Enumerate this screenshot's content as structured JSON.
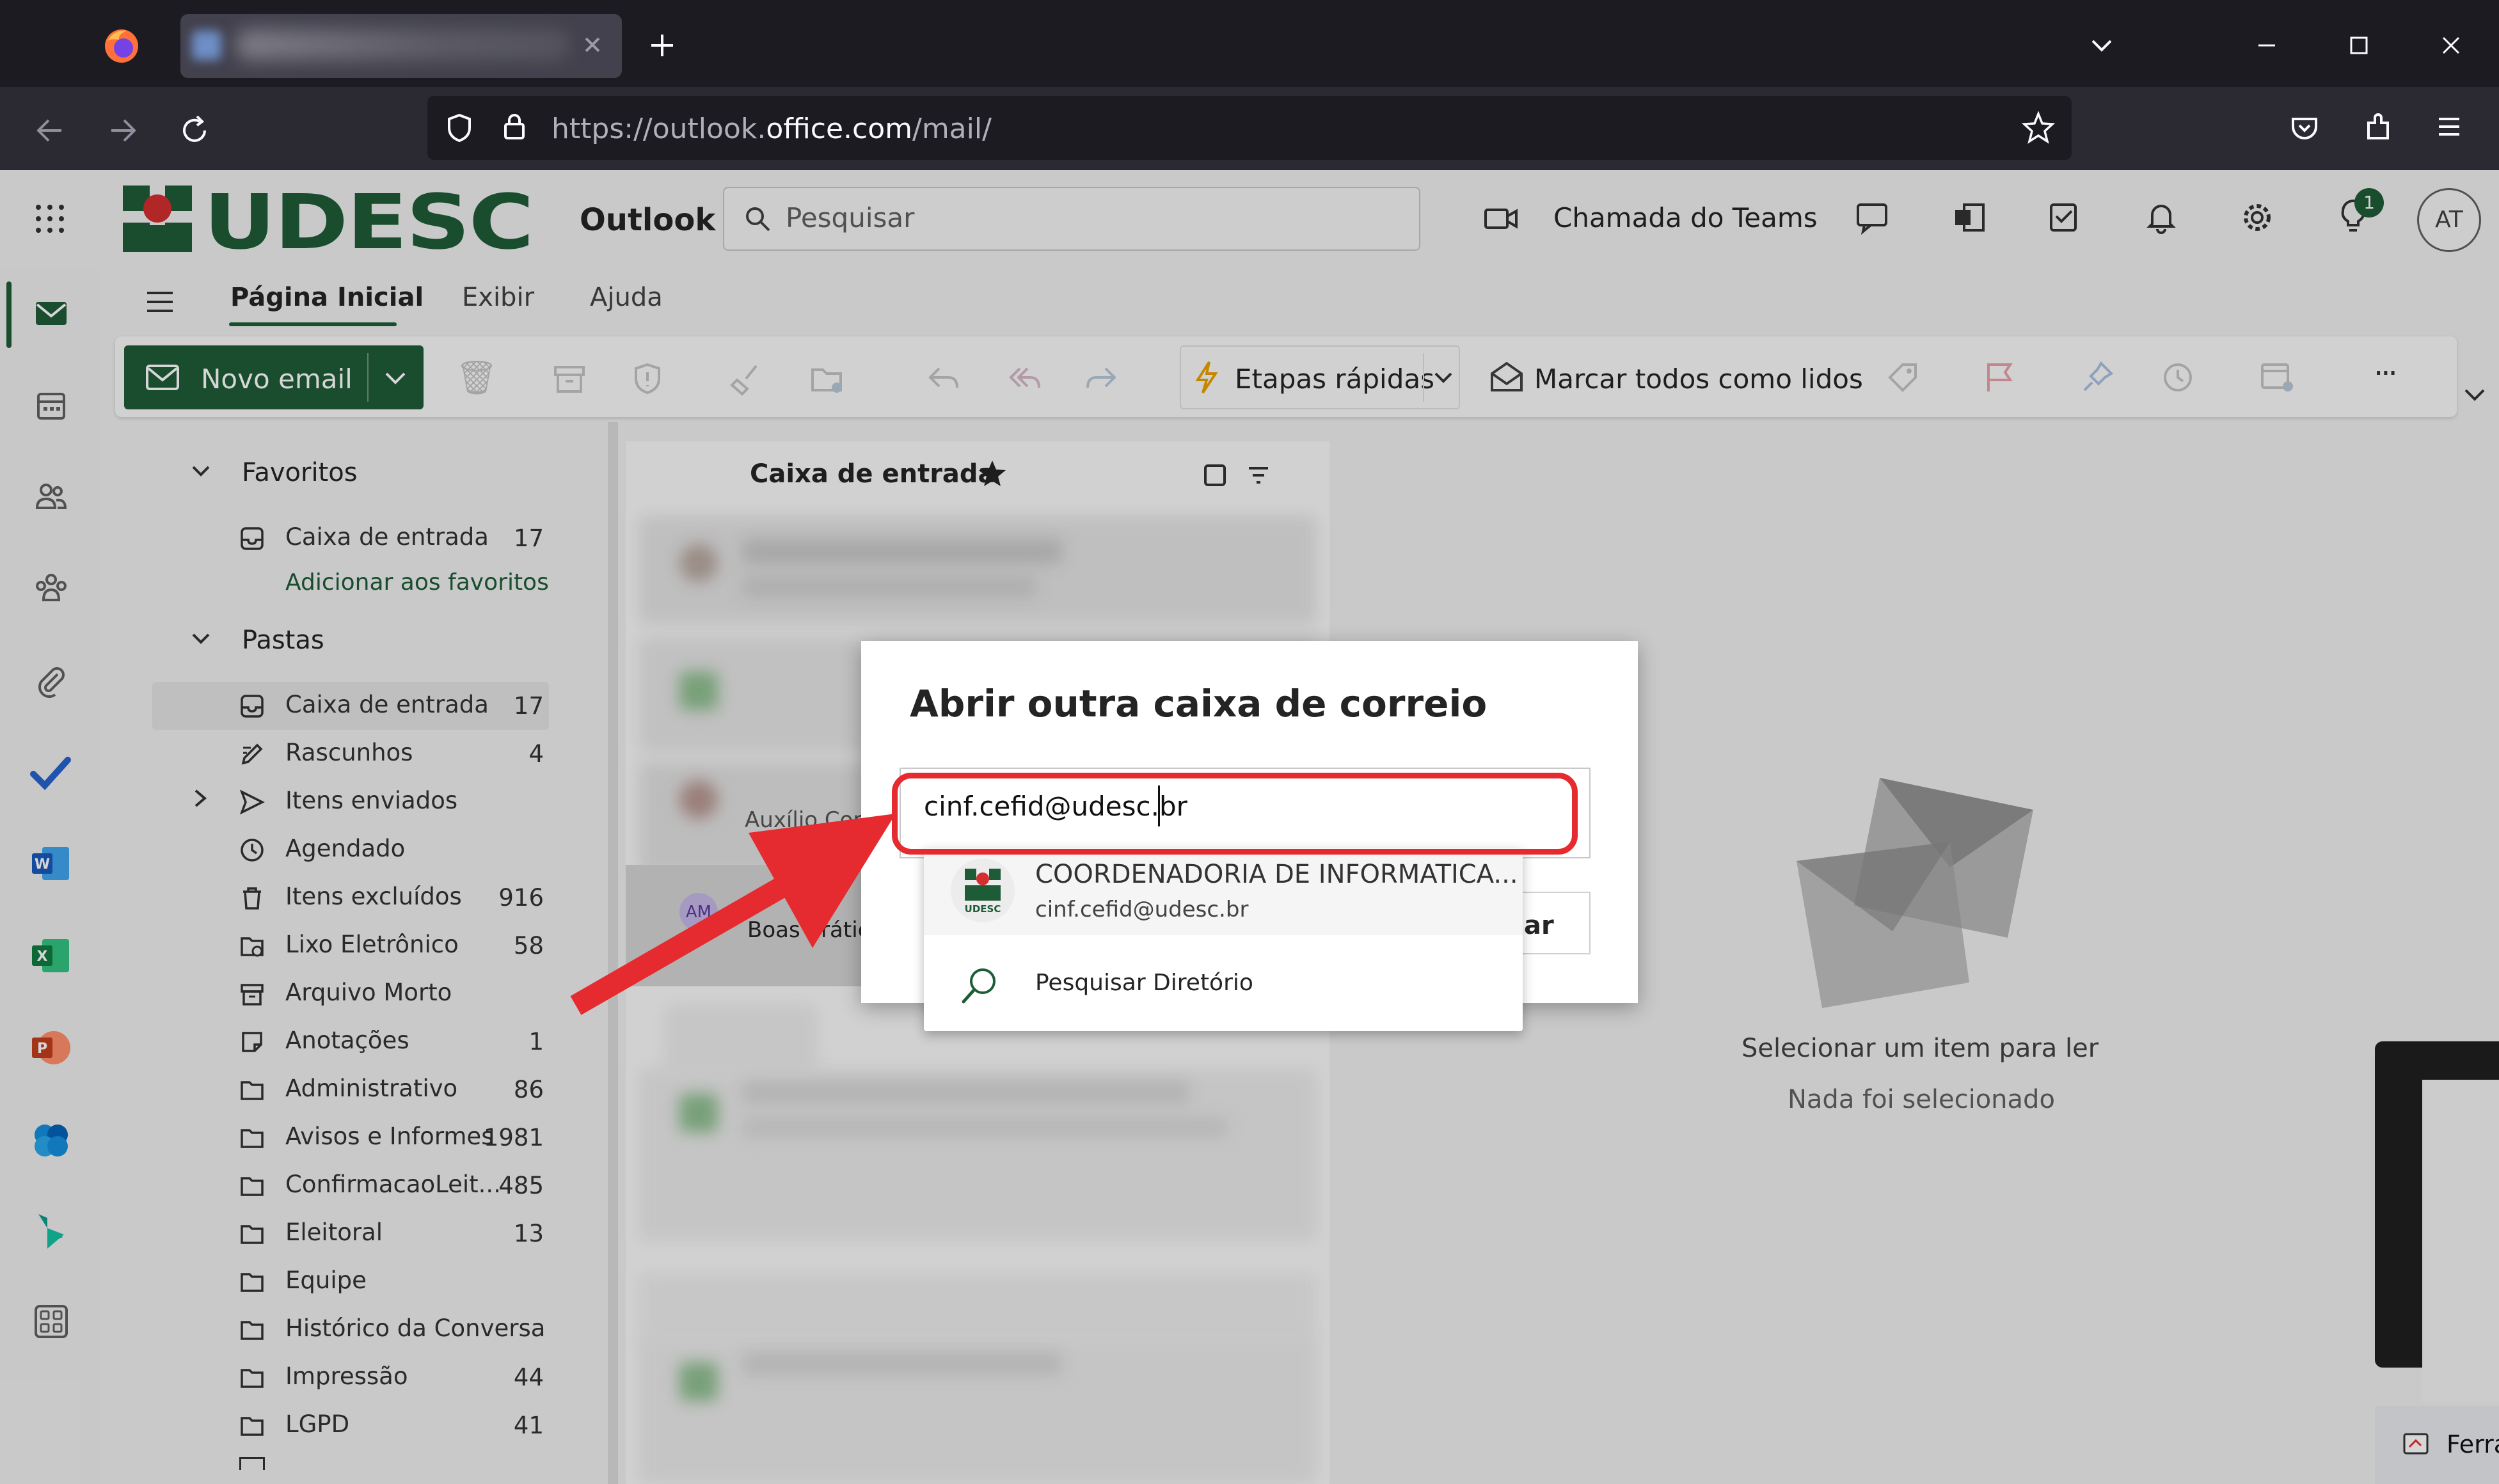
{
  "browser": {
    "url_prefix": "https://outlook.",
    "url_domain": "office.com",
    "url_suffix": "/mail/"
  },
  "header": {
    "brand": "UDESC",
    "app_name": "Outlook",
    "search_placeholder": "Pesquisar",
    "teams_call": "Chamada do Teams",
    "tips_badge": "1",
    "avatar_initials": "AT"
  },
  "tabs": {
    "home": "Página Inicial",
    "view": "Exibir",
    "help": "Ajuda"
  },
  "ribbon": {
    "new_email": "Novo email",
    "quick_steps": "Etapas rápidas",
    "mark_all_read": "Marcar todos como lidos",
    "more": "···"
  },
  "folders": {
    "favorites_header": "Favoritos",
    "favorites": [
      {
        "name": "Caixa de entrada",
        "count": "17"
      }
    ],
    "add_favorite": "Adicionar aos favoritos",
    "folders_header": "Pastas",
    "items": [
      {
        "name": "Caixa de entrada",
        "count": "17"
      },
      {
        "name": "Rascunhos",
        "count": "4"
      },
      {
        "name": "Itens enviados",
        "count": ""
      },
      {
        "name": "Agendado",
        "count": ""
      },
      {
        "name": "Itens excluídos",
        "count": "916"
      },
      {
        "name": "Lixo Eletrônico",
        "count": "58"
      },
      {
        "name": "Arquivo Morto",
        "count": ""
      },
      {
        "name": "Anotações",
        "count": "1"
      },
      {
        "name": "Administrativo",
        "count": "86"
      },
      {
        "name": "Avisos e Informes",
        "count": "1981"
      },
      {
        "name": "ConfirmacaoLeit...",
        "count": "485"
      },
      {
        "name": "Eleitoral",
        "count": "13"
      },
      {
        "name": "Equipe",
        "count": ""
      },
      {
        "name": "Histórico da Conversa",
        "count": ""
      },
      {
        "name": "Impressão",
        "count": "44"
      },
      {
        "name": "LGPD",
        "count": "41"
      }
    ]
  },
  "message_list": {
    "title": "Caixa de entrada",
    "partial_sender": "Auxílio Cor",
    "partial_preview": "Boas prátic",
    "partial_avatar": "AM"
  },
  "reading_pane": {
    "title": "Selecionar um item para ler",
    "subtitle": "Nada foi selecionado"
  },
  "dialog": {
    "title": "Abrir outra caixa de correio",
    "input_value": "cinf.cefid@udesc.br",
    "button_partial": "ar",
    "suggestion_name": "COORDENADORIA DE INFORMATICA...",
    "suggestion_email": "cinf.cefid@udesc.br",
    "search_directory": "Pesquisar Diretório"
  },
  "taskbar": {
    "partial_label": "Ferra"
  },
  "colors": {
    "outlook_blue": "#0f6cbd",
    "brand_green": "#1e5c37",
    "highlight_red": "#e52b2f"
  }
}
